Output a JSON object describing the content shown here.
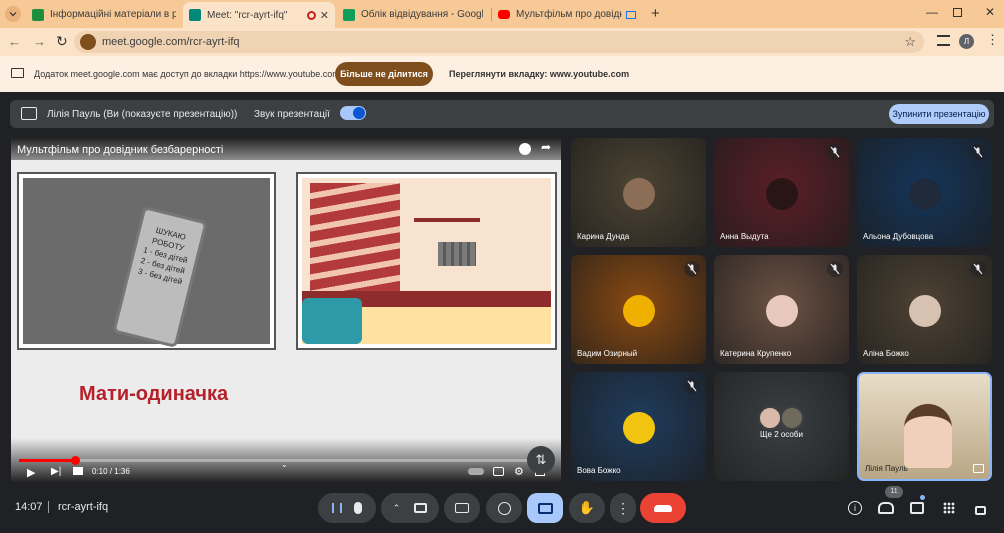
{
  "tabs": [
    {
      "title": "Інформаційні матеріали в рам",
      "color": "#1e8e3e"
    },
    {
      "title": "Meet: \"rcr-ayrt-ifq\"",
      "color": "#00897b"
    },
    {
      "title": "Облік відвідування - Google Т",
      "color": "#0f9d58"
    },
    {
      "title": "Мультфільм про довідник",
      "color": "#ff0000"
    }
  ],
  "address": {
    "url": "meet.google.com/rcr-ayrt-ifq",
    "profile_initial": "Л"
  },
  "share_bar": {
    "message": "Додаток meet.google.com має доступ до вкладки https://www.youtube.com",
    "stop_label": "Більше не ділитися",
    "view_label": "Переглянути вкладку: www.youtube.com"
  },
  "presentation": {
    "presenter_text": "Лілія Пауль (Ви (показуєте презентацію))",
    "sound_label": "Звук презентації",
    "stop_label": "Зупинити презентацію"
  },
  "video": {
    "title": "Мультфільм про довідник безбарерності",
    "caption": "Мати-одиначка",
    "time": "0:10 / 1:36",
    "progress": 0.104,
    "sign_lines": [
      "ШУКАЮ",
      "РОБОТУ",
      "1 - без дітей",
      "2 - без дітей",
      "3 - без дітей"
    ]
  },
  "participants": [
    {
      "name": "Карина Дунда",
      "bg": "#4d4433",
      "muted": false,
      "avatar": "#8b6e55"
    },
    {
      "name": "Анна Выдута",
      "bg": "#5b1f27",
      "muted": true,
      "avatar": "#2a1516"
    },
    {
      "name": "Альона Дубовцова",
      "bg": "#15355a",
      "muted": true,
      "avatar": "#1f2a3a"
    },
    {
      "name": "Вадим Озирный",
      "bg": "#8a4a12",
      "muted": true,
      "avatar": "#f0b000"
    },
    {
      "name": "Катерина Крупенко",
      "bg": "#6d5244",
      "muted": true,
      "avatar": "#e9c8bd"
    },
    {
      "name": "Аліна Божко",
      "bg": "#4e4334",
      "muted": true,
      "avatar": "#d7c1b1"
    },
    {
      "name": "Вова Божко",
      "bg": "#1f3c5e",
      "muted": true,
      "avatar": "#f1c40f"
    },
    {
      "name": "Ще 2 особи",
      "bg": "#3c4043",
      "muted": false,
      "avatar": ""
    },
    {
      "name": "Лілія Пауль",
      "bg": "#cdbfa8",
      "muted": false,
      "avatar": ""
    }
  ],
  "footer": {
    "time": "14:07",
    "meeting_code": "rcr-ayrt-ifq",
    "people_count": "11"
  },
  "colors": {
    "hangup": "#ea4335",
    "active_btn": "#a8c7fa",
    "tabbar": "#f6c997"
  }
}
